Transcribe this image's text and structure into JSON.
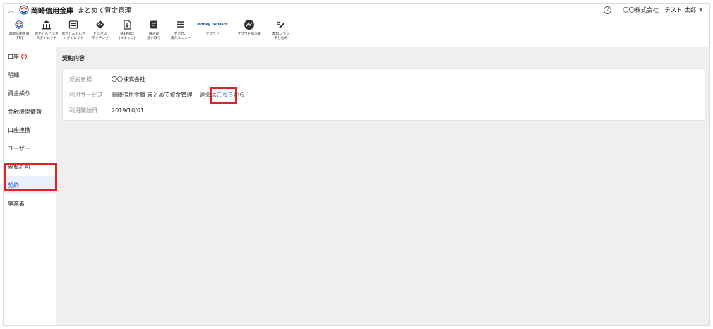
{
  "header": {
    "bank_name": "岡崎信用金庫",
    "app_name": "まとめて資金管理",
    "company": "〇〇株式会社",
    "user": "テスト 太郎"
  },
  "toolbar": {
    "items": [
      {
        "label": "岡崎信用金庫\n[FR]",
        "icon": "bank-logo-icon"
      },
      {
        "label": "おかしんビジネ\nスダイレクト",
        "icon": "bank-building-icon"
      },
      {
        "label": "おかしんでんさ\nいダイレクト",
        "icon": "document-list-icon"
      },
      {
        "label": "ビジネス\nマッチング",
        "icon": "handshake-icon"
      },
      {
        "label": "MaiNetz\n(メネッツ)",
        "icon": "file-download-icon"
      },
      {
        "label": "請求書\n読い取り",
        "icon": "invoice-icon"
      },
      {
        "label": "ヤカガ、\n法人メニュー",
        "icon": "menu-lines-icon"
      },
      {
        "label": "クラウド",
        "icon": "money-forward-logo",
        "brand": "Money Forward"
      },
      {
        "label": "クラウド請求書",
        "icon": "cloud-invoice-icon"
      },
      {
        "label": "無料プラン\n申し込み",
        "icon": "pen-signup-icon"
      }
    ]
  },
  "sidebar": {
    "items": [
      {
        "label": "口座",
        "alert": "!"
      },
      {
        "label": "明細"
      },
      {
        "label": "資金繰り"
      },
      {
        "label": "金融機関情報"
      },
      {
        "label": "口座連携"
      },
      {
        "label": "ユーザー"
      },
      {
        "label": "閲覧許可"
      },
      {
        "label": "契約"
      },
      {
        "label": "事業者"
      }
    ],
    "active_index": 7
  },
  "main": {
    "title": "契約内容",
    "rows": [
      {
        "key": "契約者様",
        "value": "〇〇株式会社"
      },
      {
        "key": "利用サービス",
        "value": "岡崎信用金庫 まとめて資金管理",
        "extra_prefix": "退会は",
        "extra_link": "こちら",
        "extra_suffix": "から"
      },
      {
        "key": "利用開始日",
        "value": "2019/10/01"
      }
    ]
  },
  "colors": {
    "accent": "#1a56c4",
    "annotation": "#e02424",
    "main_bg": "#efefef",
    "active_bg": "#e8f0fb"
  }
}
